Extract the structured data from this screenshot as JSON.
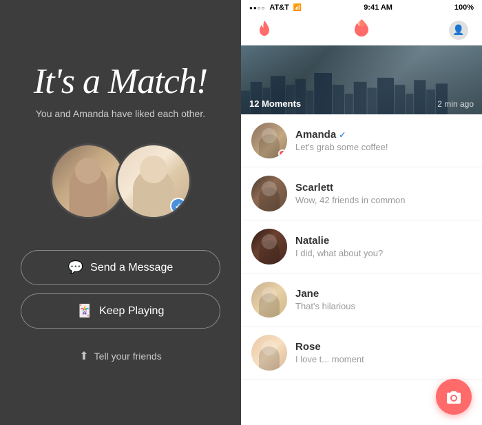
{
  "left": {
    "title_line1": "It's a",
    "title_line2": "Match!",
    "subtitle": "You and Amanda have liked each other.",
    "buttons": {
      "send_message": "Send a Message",
      "keep_playing": "Keep Playing",
      "tell_friends": "Tell your friends"
    }
  },
  "right": {
    "status_bar": {
      "signal": "●●○○",
      "carrier": "AT&T",
      "wifi": "WiFi",
      "time": "9:41 AM",
      "battery": "100%"
    },
    "moments": {
      "count": "12 Moments",
      "time_ago": "2 min ago"
    },
    "messages": [
      {
        "name": "Amanda",
        "verified": true,
        "online": true,
        "text": "Let's grab some coffee!",
        "avatar_class": "msg-avatar-1"
      },
      {
        "name": "Scarlett",
        "verified": false,
        "online": false,
        "text": "Wow, 42 friends in common",
        "avatar_class": "msg-avatar-2"
      },
      {
        "name": "Natalie",
        "verified": false,
        "online": false,
        "text": "I did, what about you?",
        "avatar_class": "msg-avatar-3"
      },
      {
        "name": "Jane",
        "verified": false,
        "online": false,
        "text": "That's hilarious",
        "avatar_class": "msg-avatar-4"
      },
      {
        "name": "Rose",
        "verified": false,
        "online": false,
        "text": "I love t... moment",
        "avatar_class": "msg-avatar-5"
      }
    ]
  }
}
